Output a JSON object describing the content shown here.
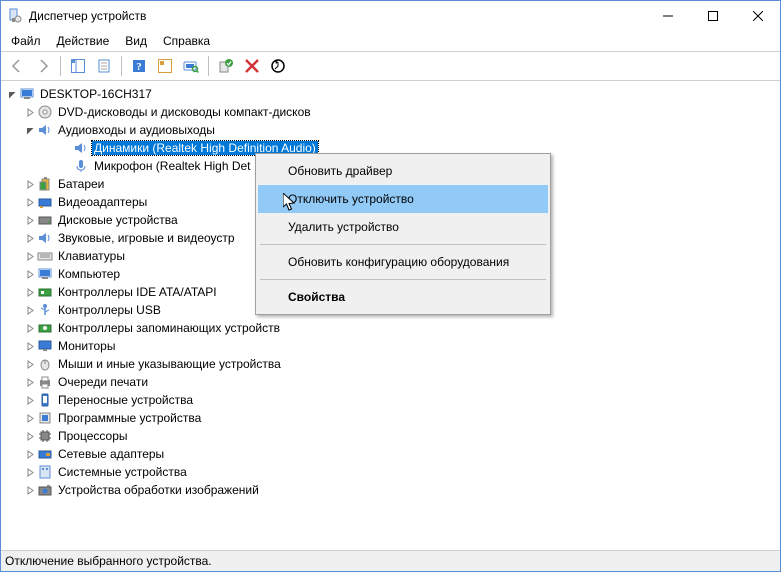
{
  "window": {
    "title": "Диспетчер устройств"
  },
  "menubar": {
    "file": "Файл",
    "action": "Действие",
    "view": "Вид",
    "help": "Справка"
  },
  "tree": {
    "root": "DESKTOP-16CH317",
    "dvd": "DVD-дисководы и дисководы компакт-дисков",
    "audio": "Аудиовходы и аудиовыходы",
    "speakers": "Динамики (Realtek High Definition Audio)",
    "microphone": "Микрофон (Realtek High Det",
    "batteries": "Батареи",
    "display_adapters": "Видеоадаптеры",
    "disk_drives": "Дисковые устройства",
    "sound_video_game": "Звуковые, игровые и видеоустр",
    "keyboards": "Клавиатуры",
    "computer": "Компьютер",
    "ide_ata": "Контроллеры IDE ATA/ATAPI",
    "usb_controllers": "Контроллеры USB",
    "storage_controllers": "Контроллеры запоминающих устройств",
    "monitors": "Мониторы",
    "mice": "Мыши и иные указывающие устройства",
    "print_queues": "Очереди печати",
    "portable": "Переносные устройства",
    "software_devices": "Программные устройства",
    "processors": "Процессоры",
    "network_adapters": "Сетевые адаптеры",
    "system_devices": "Системные устройства",
    "imaging": "Устройства обработки изображений"
  },
  "context_menu": {
    "update_driver": "Обновить драйвер",
    "disable_device": "Отключить устройство",
    "uninstall_device": "Удалить устройство",
    "scan_hardware": "Обновить конфигурацию оборудования",
    "properties": "Свойства"
  },
  "statusbar": {
    "text": "Отключение выбранного устройства."
  }
}
